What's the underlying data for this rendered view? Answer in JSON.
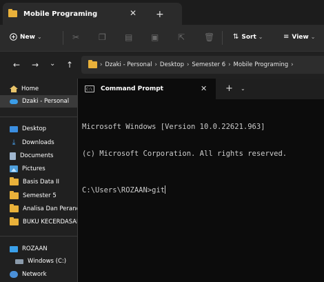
{
  "explorer": {
    "tab": {
      "title": "Mobile Programing",
      "close_glyph": "✕",
      "add_glyph": "+"
    },
    "commandbar": {
      "new_label": "New",
      "sort_label": "Sort",
      "view_label": "View",
      "chevron": "⌄"
    },
    "nav": {
      "back": "←",
      "forward": "→",
      "recent": "⌄",
      "up": "↑"
    },
    "breadcrumb": [
      "Dzaki - Personal",
      "Desktop",
      "Semester 6",
      "Mobile Programing"
    ],
    "breadcrumb_sep": "›",
    "sidebar": [
      {
        "label": "Home",
        "icon": "home-icon"
      },
      {
        "label": "Dzaki - Personal",
        "icon": "cloud-icon",
        "selected": true
      },
      {
        "label": "Desktop",
        "icon": "desktop-icon"
      },
      {
        "label": "Downloads",
        "icon": "download-icon"
      },
      {
        "label": "Documents",
        "icon": "document-icon"
      },
      {
        "label": "Pictures",
        "icon": "pictures-icon"
      },
      {
        "label": "Basis Data II",
        "icon": "folder-icon"
      },
      {
        "label": "Semester 5",
        "icon": "folder-icon"
      },
      {
        "label": "Analisa Dan Perancangan",
        "icon": "folder-icon"
      },
      {
        "label": "BUKU KECERDASAN",
        "icon": "folder-icon"
      },
      {
        "label": "ROZAAN",
        "icon": "pc-icon"
      },
      {
        "label": "Windows (C:)",
        "icon": "drive-icon"
      },
      {
        "label": "Network",
        "icon": "network-icon"
      }
    ]
  },
  "terminal": {
    "tab_title": "Command Prompt",
    "close_glyph": "✕",
    "new_glyph": "+",
    "dropdown_glyph": "⌄",
    "lines": [
      "Microsoft Windows [Version 10.0.22621.963]",
      "(c) Microsoft Corporation. All rights reserved."
    ],
    "prompt": "C:\\Users\\ROZAAN>",
    "input": "git"
  }
}
